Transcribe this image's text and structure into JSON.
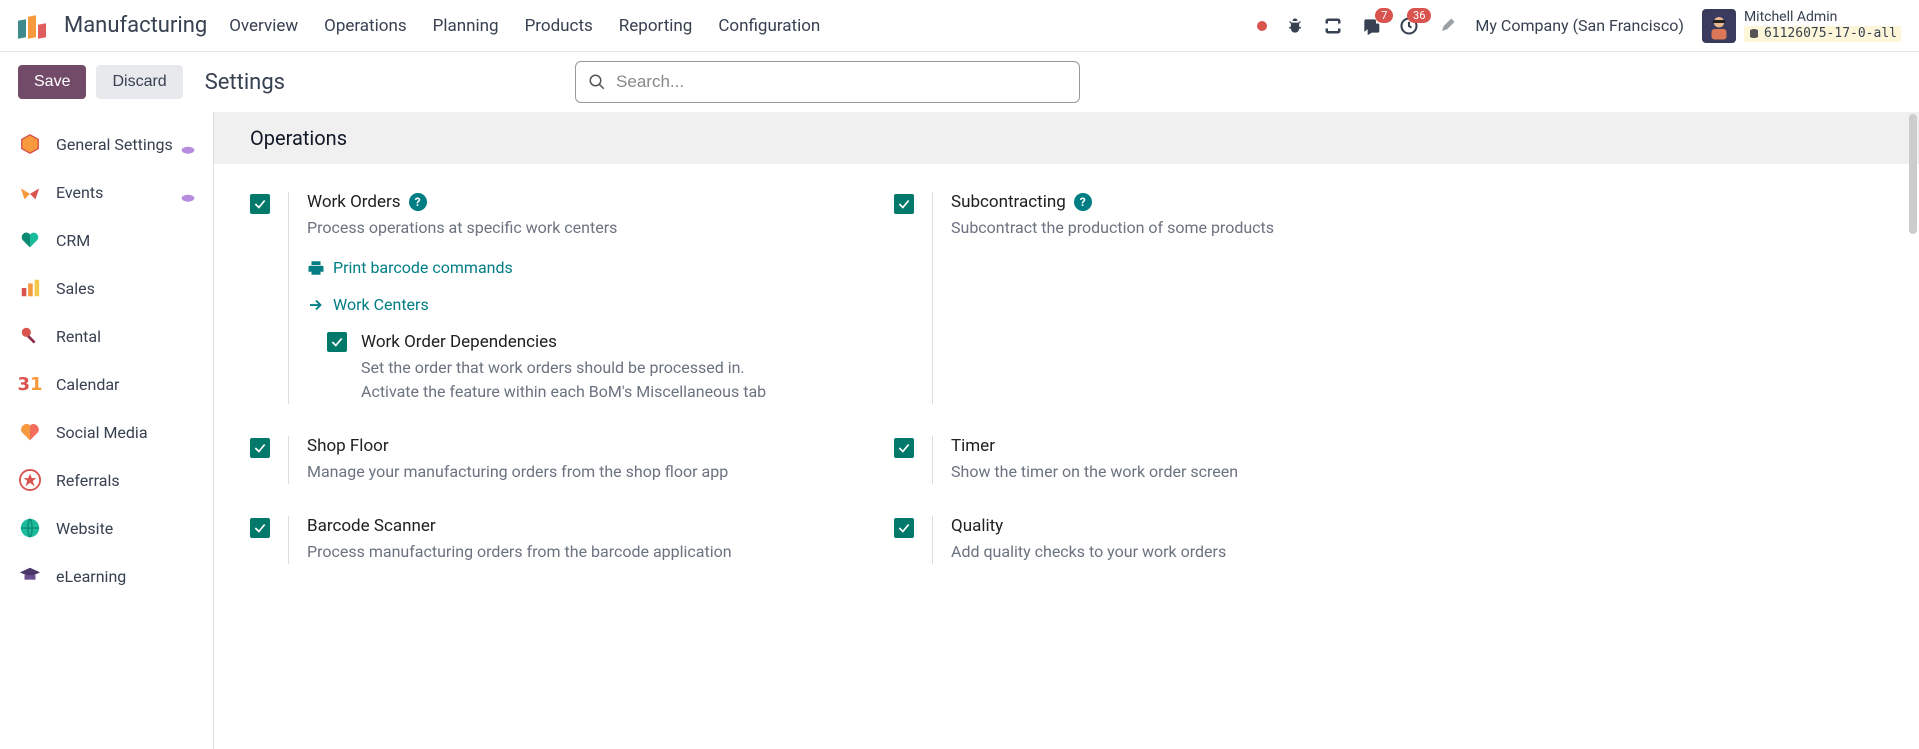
{
  "header": {
    "app_title": "Manufacturing",
    "menu": [
      "Overview",
      "Operations",
      "Planning",
      "Products",
      "Reporting",
      "Configuration"
    ],
    "badges": {
      "messages": "7",
      "activities": "36"
    },
    "company": "My Company (San Francisco)",
    "user": {
      "name": "Mitchell Admin",
      "db": "61126075-17-0-all"
    }
  },
  "controlbar": {
    "save": "Save",
    "discard": "Discard",
    "breadcrumb": "Settings",
    "search_placeholder": "Search..."
  },
  "sidebar": [
    {
      "label": "General Settings",
      "fav": true,
      "icon": "hexagon",
      "color": "#f79a3e"
    },
    {
      "label": "Events",
      "fav": true,
      "icon": "triangles",
      "color": "#f79a3e"
    },
    {
      "label": "CRM",
      "fav": false,
      "icon": "heart",
      "color": "#1abc9c"
    },
    {
      "label": "Sales",
      "fav": false,
      "icon": "bars",
      "color": "#f79a3e"
    },
    {
      "label": "Rental",
      "fav": false,
      "icon": "key",
      "color": "#d9534f"
    },
    {
      "label": "Calendar",
      "fav": false,
      "icon": "calendar",
      "color": "#f79a3e"
    },
    {
      "label": "Social Media",
      "fav": false,
      "icon": "heart2",
      "color": "#f26d5b"
    },
    {
      "label": "Referrals",
      "fav": false,
      "icon": "star",
      "color": "#d9534f"
    },
    {
      "label": "Website",
      "fav": false,
      "icon": "globe",
      "color": "#1abc9c"
    },
    {
      "label": "eLearning",
      "fav": false,
      "icon": "cap",
      "color": "#4b3869"
    }
  ],
  "content": {
    "section_title": "Operations",
    "settings": {
      "work_orders": {
        "title": "Work Orders",
        "desc": "Process operations at specific work centers",
        "link1": "Print barcode commands",
        "link2": "Work Centers",
        "sub": {
          "title": "Work Order Dependencies",
          "desc1": "Set the order that work orders should be processed in.",
          "desc2": "Activate the feature within each BoM's Miscellaneous tab"
        }
      },
      "subcontracting": {
        "title": "Subcontracting",
        "desc": "Subcontract the production of some products"
      },
      "shop_floor": {
        "title": "Shop Floor",
        "desc": "Manage your manufacturing orders from the shop floor app"
      },
      "timer": {
        "title": "Timer",
        "desc": "Show the timer on the work order screen"
      },
      "barcode": {
        "title": "Barcode Scanner",
        "desc": "Process manufacturing orders from the barcode application"
      },
      "quality": {
        "title": "Quality",
        "desc": "Add quality checks to your work orders"
      }
    }
  }
}
